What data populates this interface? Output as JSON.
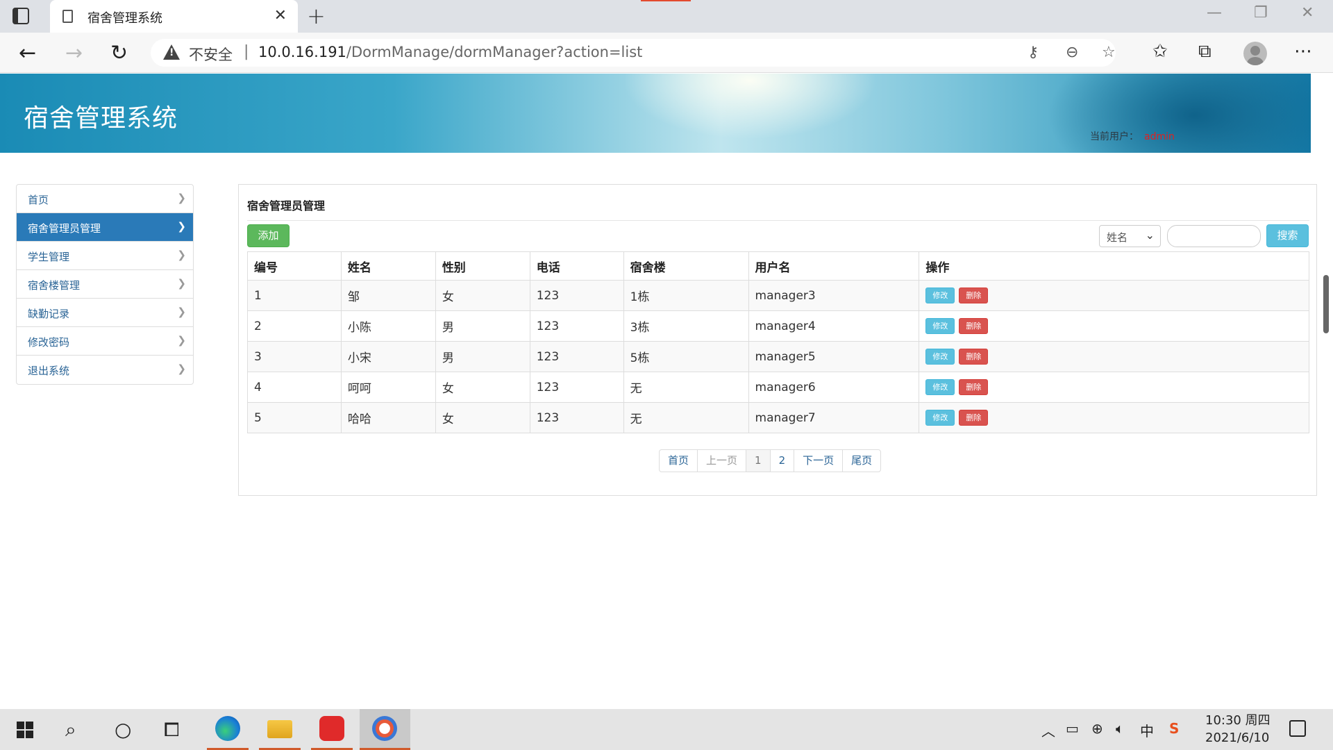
{
  "browser": {
    "tab_title": "宿舍管理系统",
    "tab_close": "✕",
    "new_tab": "+",
    "security_label": "不安全",
    "separator": "|",
    "url_host": "10.0.16.191",
    "url_path": "/DormManage/dormManager?action=list"
  },
  "header": {
    "app_title": "宿舍管理系统",
    "current_user_label": "当前用户：",
    "current_user": "admin"
  },
  "sidebar": {
    "items": [
      {
        "label": "首页"
      },
      {
        "label": "宿舍管理员管理"
      },
      {
        "label": "学生管理"
      },
      {
        "label": "宿舍楼管理"
      },
      {
        "label": "缺勤记录"
      },
      {
        "label": "修改密码"
      },
      {
        "label": "退出系统"
      }
    ]
  },
  "main": {
    "title": "宿舍管理员管理",
    "add_label": "添加",
    "search_field_selected": "姓名",
    "search_value": "",
    "search_label": "搜索",
    "table": {
      "headers": [
        "编号",
        "姓名",
        "性别",
        "电话",
        "宿舍楼",
        "用户名",
        "操作"
      ],
      "rows": [
        [
          "1",
          "邹",
          "女",
          "123",
          "1栋",
          "manager3"
        ],
        [
          "2",
          "小陈",
          "男",
          "123",
          "3栋",
          "manager4"
        ],
        [
          "3",
          "小宋",
          "男",
          "123",
          "5栋",
          "manager5"
        ],
        [
          "4",
          "呵呵",
          "女",
          "123",
          "无",
          "manager6"
        ],
        [
          "5",
          "哈哈",
          "女",
          "123",
          "无",
          "manager7"
        ]
      ],
      "edit_label": "修改",
      "delete_label": "删除"
    },
    "pagination": {
      "first": "首页",
      "prev": "上一页",
      "pages": [
        "1",
        "2"
      ],
      "current_page": "1",
      "next": "下一页",
      "last": "尾页"
    }
  },
  "taskbar": {
    "time": "10:30 周四",
    "date": "2021/6/10",
    "ime": "中"
  },
  "colors": {
    "active_nav": "#2a7ab8",
    "add_button": "#5cb85c",
    "search_button": "#5bc0de",
    "edit_button": "#5bc0de",
    "delete_button": "#d9534f",
    "current_user_name": "#e02020"
  }
}
